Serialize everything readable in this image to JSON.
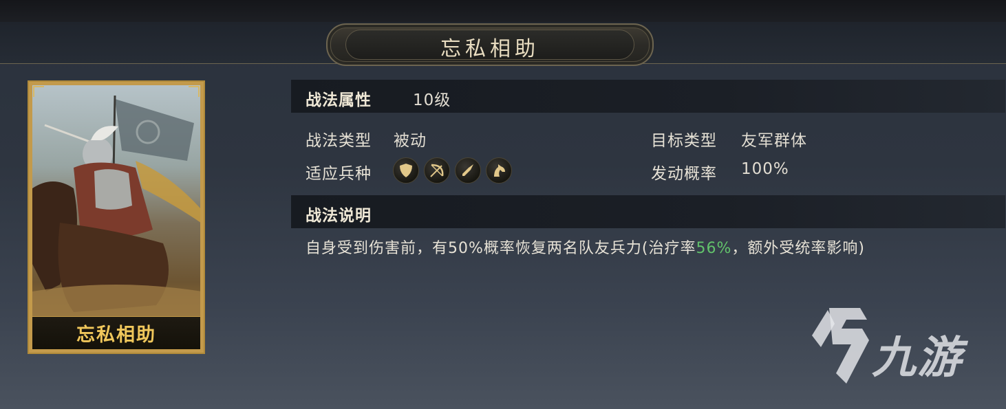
{
  "header": {
    "title": "忘私相助"
  },
  "card": {
    "name": "忘私相助"
  },
  "attributes": {
    "section_label": "战法属性",
    "level": "10级",
    "type_label": "战法类型",
    "type_value": "被动",
    "target_label": "目标类型",
    "target_value": "友军群体",
    "units_label": "适应兵种",
    "units_icons": [
      "shield-icon",
      "bow-icon",
      "spear-icon",
      "horse-icon"
    ],
    "trigger_label": "发动概率",
    "trigger_value": "100%"
  },
  "description": {
    "section_label": "战法说明",
    "text_before": "自身受到伤害前，有50%概率恢复两名队友兵力(治疗率",
    "highlight": "56%",
    "text_after": "，额外受统率影响)",
    "highlight_color": "#62c26b"
  },
  "watermark": {
    "text": "九游"
  }
}
